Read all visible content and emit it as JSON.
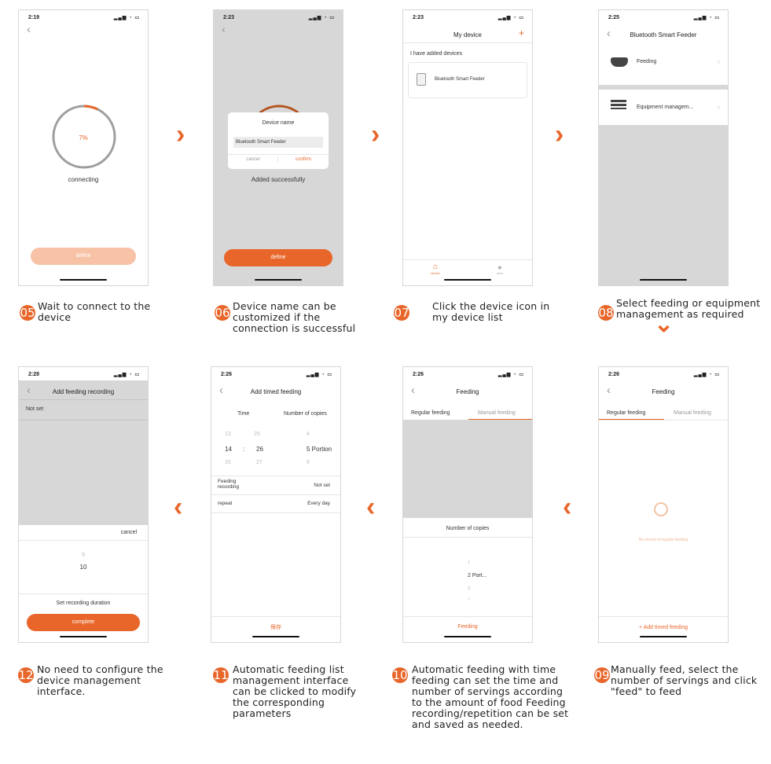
{
  "accent_color": "#e8662a",
  "screens": {
    "s05": {
      "time": "2:19",
      "percent": "7%",
      "status": "connecting",
      "button": "define"
    },
    "s06": {
      "time": "2:23",
      "dialog_title": "Device name",
      "device_name": "Bluetooth Smart Feeder",
      "cancel": "cancel",
      "confirm": "confirm",
      "status": "Added successfully",
      "button": "define"
    },
    "s07": {
      "time": "2:23",
      "title": "My device",
      "add": "+",
      "section": "I have added devices",
      "device": "Bluetooth Smart Feeder",
      "tab_device": "device",
      "tab_mine": "mine"
    },
    "s08": {
      "time": "2:25",
      "title": "Bluetooth Smart Feeder",
      "item1": "Feeding",
      "item2": "Equipment managem..."
    },
    "s09": {
      "time": "2:26",
      "title": "Feeding",
      "tab1": "Regular feeding",
      "tab2": "Manual feeding",
      "empty": "No record of regular feeding",
      "add": "+ Add timed feeding"
    },
    "s10": {
      "time": "2:26",
      "title": "Feeding",
      "tab1": "Regular feeding",
      "tab2": "Manual feeding",
      "label": "Number of copies",
      "opts": [
        "1",
        "2  Port...",
        "3",
        "4"
      ],
      "button": "Feeding"
    },
    "s11": {
      "time": "2:26",
      "title": "Add timed feeding",
      "col1": "Time",
      "col2": "Number of copies",
      "h_prev": "13",
      "m_prev": "25",
      "h": "14",
      "colon": ":",
      "m": "26",
      "h_next": "15",
      "m_next": "27",
      "c_prev": "4",
      "c": "5  Portion",
      "c_next": "6",
      "row1_label": "Feeding recording",
      "row1_value": "Not set",
      "row2_label": "repeat",
      "row2_value": "Every day",
      "save": "保存"
    },
    "s12": {
      "time": "2:28",
      "title": "Add feeding recording",
      "value": "Not set",
      "cancel": "cancel",
      "prev": "9",
      "current": "10",
      "label": "Set recording duration",
      "button": "complete"
    }
  },
  "steps": [
    {
      "num": "05",
      "text": "Wait to connect to the device"
    },
    {
      "num": "06",
      "text": "Device name can be customized if the connection is successful"
    },
    {
      "num": "07",
      "text": "Click the device icon in my device list"
    },
    {
      "num": "08",
      "text": "Select feeding or equipment management as required"
    },
    {
      "num": "09",
      "text": "Manually feed, select the number of servings and click \"feed\" to feed"
    },
    {
      "num": "10",
      "text": " Automatic feeding with time feeding can set the time and number of servings according to the amount of food Feeding recording/repetition can be set and saved as needed."
    },
    {
      "num": "11",
      "text": "Automatic feeding list management interface can be clicked to modify the corresponding parameters"
    },
    {
      "num": "12",
      "text": "No need to configure the device management interface."
    }
  ],
  "arrows": {
    "right": "›",
    "left": "‹",
    "down": "⌄"
  }
}
